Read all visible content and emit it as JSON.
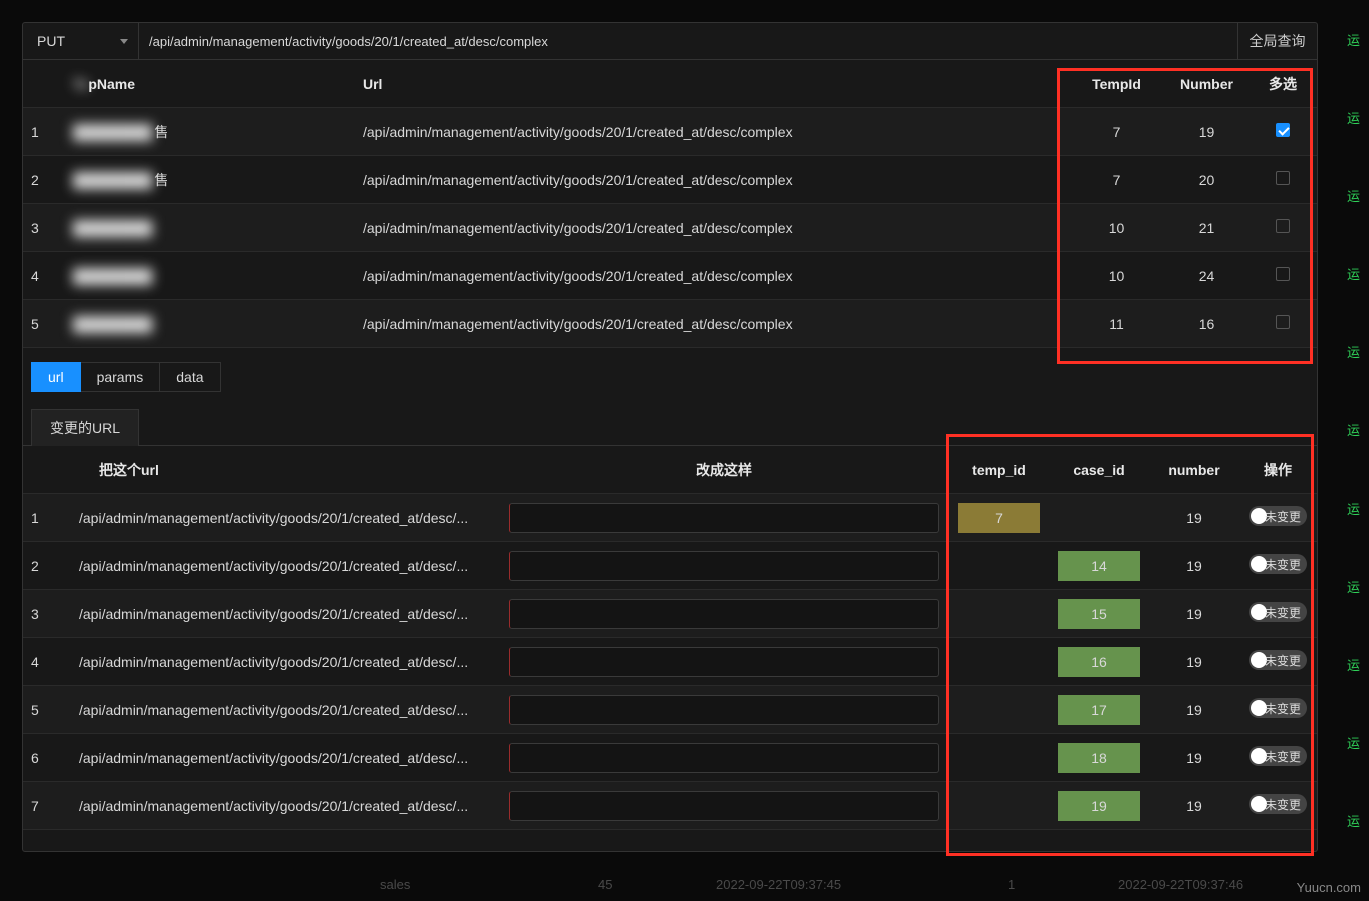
{
  "topbar": {
    "method": "PUT",
    "url_value": "/api/admin/management/activity/goods/20/1/created_at/desc/complex",
    "global_search": "全局查询"
  },
  "table1": {
    "headers": {
      "name": "pName",
      "url": "Url",
      "tempid": "TempId",
      "number": "Number",
      "multi": "多选"
    },
    "rows": [
      {
        "idx": "1",
        "name_blur": "████████",
        "name_suffix": "售",
        "url": "/api/admin/management/activity/goods/20/1/created_at/desc/complex",
        "tempid": "7",
        "number": "19",
        "checked": true
      },
      {
        "idx": "2",
        "name_blur": "████████",
        "name_suffix": "售",
        "url": "/api/admin/management/activity/goods/20/1/created_at/desc/complex",
        "tempid": "7",
        "number": "20",
        "checked": false
      },
      {
        "idx": "3",
        "name_blur": "████████",
        "name_suffix": "",
        "url": "/api/admin/management/activity/goods/20/1/created_at/desc/complex",
        "tempid": "10",
        "number": "21",
        "checked": false
      },
      {
        "idx": "4",
        "name_blur": "████████",
        "name_suffix": "",
        "url": "/api/admin/management/activity/goods/20/1/created_at/desc/complex",
        "tempid": "10",
        "number": "24",
        "checked": false
      },
      {
        "idx": "5",
        "name_blur": "████████",
        "name_suffix": "",
        "url": "/api/admin/management/activity/goods/20/1/created_at/desc/complex",
        "tempid": "11",
        "number": "16",
        "checked": false
      }
    ]
  },
  "tabs": {
    "url": "url",
    "params": "params",
    "data": "data"
  },
  "sub_tab": "变更的URL",
  "table2": {
    "headers": {
      "url": "把这个url",
      "change_to": "改成这样",
      "tempid": "temp_id",
      "caseid": "case_id",
      "number": "number",
      "op": "操作"
    },
    "switch_label": "未变更",
    "rows": [
      {
        "idx": "1",
        "url": "/api/admin/management/activity/goods/20/1/created_at/desc/...",
        "tempid": "7",
        "tempid_hl": "olive",
        "caseid": "",
        "caseid_hl": "",
        "number": "19"
      },
      {
        "idx": "2",
        "url": "/api/admin/management/activity/goods/20/1/created_at/desc/...",
        "tempid": "",
        "tempid_hl": "",
        "caseid": "14",
        "caseid_hl": "green",
        "number": "19"
      },
      {
        "idx": "3",
        "url": "/api/admin/management/activity/goods/20/1/created_at/desc/...",
        "tempid": "",
        "tempid_hl": "",
        "caseid": "15",
        "caseid_hl": "green",
        "number": "19"
      },
      {
        "idx": "4",
        "url": "/api/admin/management/activity/goods/20/1/created_at/desc/...",
        "tempid": "",
        "tempid_hl": "",
        "caseid": "16",
        "caseid_hl": "green",
        "number": "19"
      },
      {
        "idx": "5",
        "url": "/api/admin/management/activity/goods/20/1/created_at/desc/...",
        "tempid": "",
        "tempid_hl": "",
        "caseid": "17",
        "caseid_hl": "green",
        "number": "19"
      },
      {
        "idx": "6",
        "url": "/api/admin/management/activity/goods/20/1/created_at/desc/...",
        "tempid": "",
        "tempid_hl": "",
        "caseid": "18",
        "caseid_hl": "green",
        "number": "19"
      },
      {
        "idx": "7",
        "url": "/api/admin/management/activity/goods/20/1/created_at/desc/...",
        "tempid": "",
        "tempid_hl": "",
        "caseid": "19",
        "caseid_hl": "green",
        "number": "19"
      }
    ]
  },
  "bottom": {
    "col1": "sales",
    "col2": "45",
    "col3": "2022-09-22T09:37:45",
    "col4": "1",
    "col5": "2022-09-22T09:37:46"
  },
  "watermark": "Yuucn.com",
  "right_strip_char": "运"
}
